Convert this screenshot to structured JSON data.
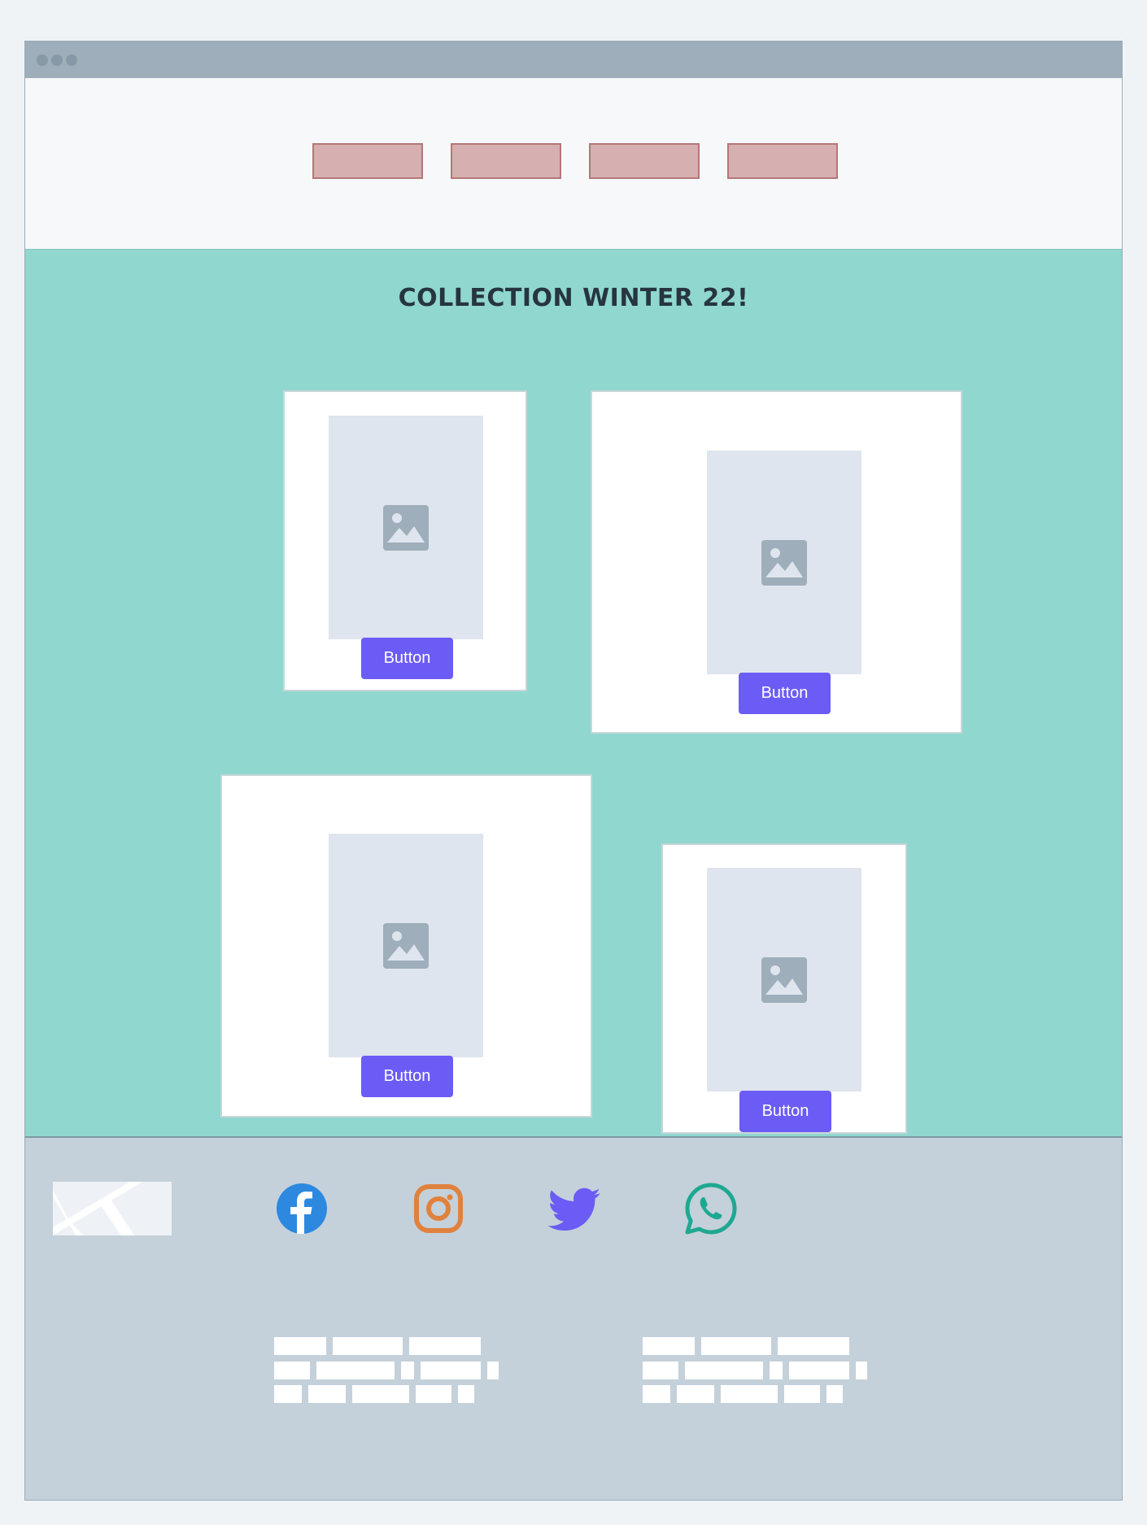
{
  "hero": {
    "title": "COLLECTION WINTER 22!"
  },
  "cards": [
    {
      "button_label": "Button"
    },
    {
      "button_label": "Button"
    },
    {
      "button_label": "Button"
    },
    {
      "button_label": "Button"
    }
  ],
  "colors": {
    "accent_button": "#6b5cf6",
    "hero_background": "#90d7cf",
    "nav_placeholder": "#d6b0b1",
    "footer_background": "#c4d1da",
    "facebook": "#2d88e0",
    "instagram": "#e0823e",
    "twitter": "#6b5cf6",
    "whatsapp": "#1fa891"
  },
  "footer": {
    "social_icons": [
      "facebook-icon",
      "instagram-icon",
      "twitter-icon",
      "whatsapp-icon"
    ]
  }
}
